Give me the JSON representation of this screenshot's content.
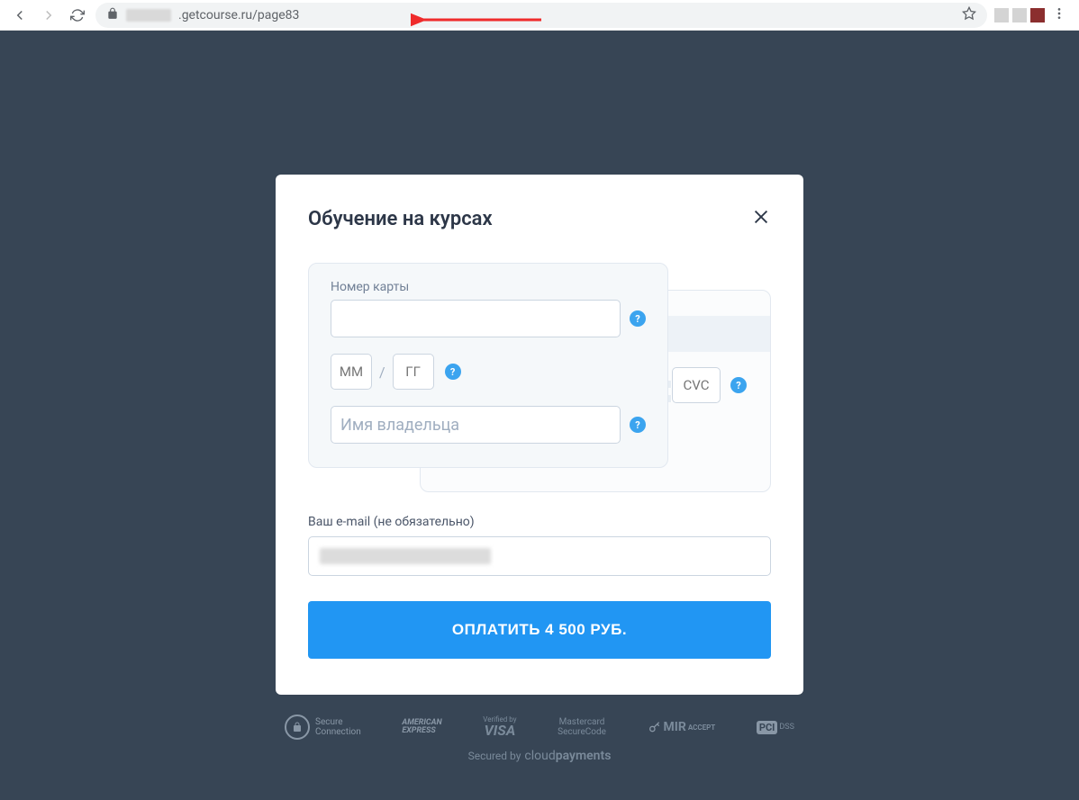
{
  "browser": {
    "url_suffix": ".getcourse.ru/page83"
  },
  "modal": {
    "title": "Обучение на курсах",
    "card_number_label": "Номер карты",
    "exp_mm_placeholder": "ММ",
    "exp_yy_placeholder": "ГГ",
    "owner_placeholder": "Имя владельца",
    "cvc_placeholder": "CVC",
    "email_label": "Ваш e-mail (не обязательно)",
    "pay_button": "ОПЛАТИТЬ 4 500 РУБ."
  },
  "footer": {
    "secure_line1": "Secure",
    "secure_line2": "Connection",
    "amex1": "AMERICAN",
    "amex2": "EXPRESS",
    "visa_small": "Verified by",
    "visa_big": "VISA",
    "mc1": "Mastercard",
    "mc2": "SecureCode",
    "mir": "MIR",
    "mir_small": "ACCEPT",
    "pci": "PCI",
    "pci_small": "DSS",
    "secured_by": "Secured by",
    "cp1": "cloud",
    "cp2": "payments"
  }
}
